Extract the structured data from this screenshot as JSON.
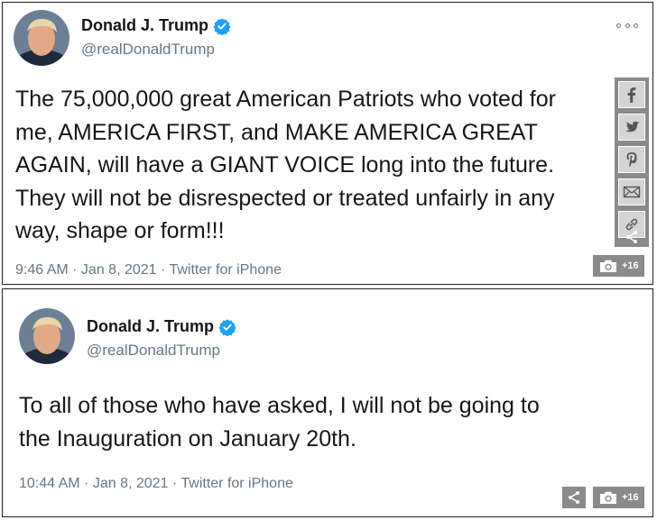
{
  "tweets": [
    {
      "display_name": "Donald J. Trump",
      "handle": "@realDonaldTrump",
      "text": "The 75,000,000 great American Patriots who voted for\nme, AMERICA FIRST, and MAKE AMERICA GREAT\nAGAIN, will have a GIANT VOICE long into the future.\nThey will not be disrespected or treated unfairly in any\nway, shape or form!!!",
      "meta": "9:46 AM · Jan 8, 2021 · Twitter for iPhone",
      "photo_count": "+16"
    },
    {
      "display_name": "Donald J. Trump",
      "handle": "@realDonaldTrump",
      "text": "To all of those who have asked, I will not be going to\nthe Inauguration on January 20th.",
      "meta": "10:44 AM · Jan 8, 2021 · Twitter for iPhone",
      "photo_count": "+16"
    }
  ],
  "icons": {
    "verified": "verified-badge-icon",
    "more": "more-options-icon",
    "share_bar": [
      "facebook-icon",
      "twitter-icon",
      "pinterest-icon",
      "email-icon",
      "link-icon",
      "share-icon"
    ],
    "photo": "camera-icon"
  },
  "colors": {
    "verified_blue": "#1da1f2",
    "text_primary": "#14171a",
    "text_secondary": "#657786",
    "share_bar_bg": "#8a8a8a",
    "share_button_bg": "#d4d4d4"
  }
}
